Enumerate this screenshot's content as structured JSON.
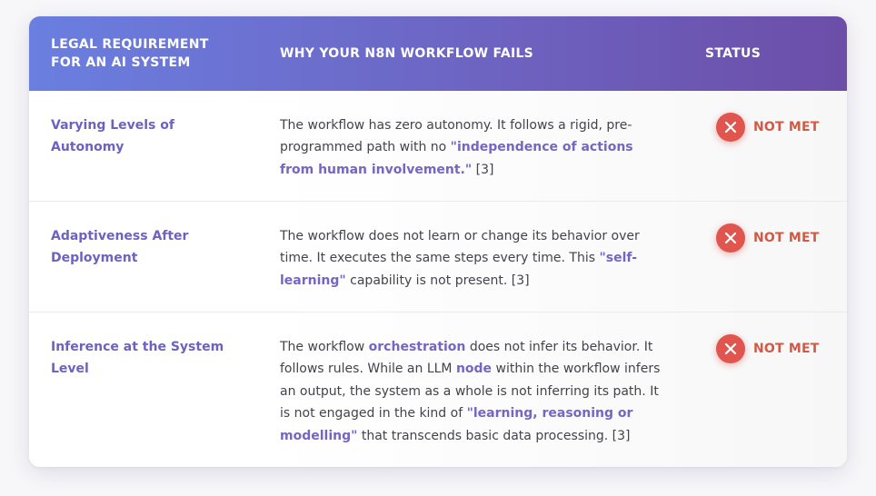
{
  "table": {
    "headers": {
      "requirement": "LEGAL REQUIREMENT FOR AN AI SYSTEM",
      "reason": "WHY YOUR N8N WORKFLOW FAILS",
      "status": "STATUS"
    },
    "rows": [
      {
        "requirement": "Varying Levels of Autonomy",
        "reason": {
          "t1": "The workflow has zero autonomy. It follows a rigid, pre-programmed path with no ",
          "h1": "\"independence of actions from human involvement.\"",
          "t2": " [3]"
        },
        "status": "NOT MET"
      },
      {
        "requirement": "Adaptiveness After Deployment",
        "reason": {
          "t1": "The workflow does not learn or change its behavior over time. It executes the same steps every time. This ",
          "h1": "\"self-learning\"",
          "t2": " capability is not present. [3]"
        },
        "status": "NOT MET"
      },
      {
        "requirement": "Inference at the System Level",
        "reason": {
          "t1": "The workflow ",
          "h1": "orchestration",
          "t2": " does not infer its behavior. It follows rules. While an LLM ",
          "h2": "node",
          "t3": " within the workflow infers an output, the system as a whole is not inferring its path. It is not engaged in the kind of ",
          "h3": "\"learning, reasoning or modelling\"",
          "t4": " that transcends basic data processing. [3]"
        },
        "status": "NOT MET"
      }
    ]
  },
  "colors": {
    "header_gradient_start": "#6a7fe0",
    "header_gradient_end": "#6c4ea8",
    "accent_text": "#6b63bf",
    "status_red": "#e0564f"
  },
  "icons": {
    "status": "close-circle-icon"
  }
}
